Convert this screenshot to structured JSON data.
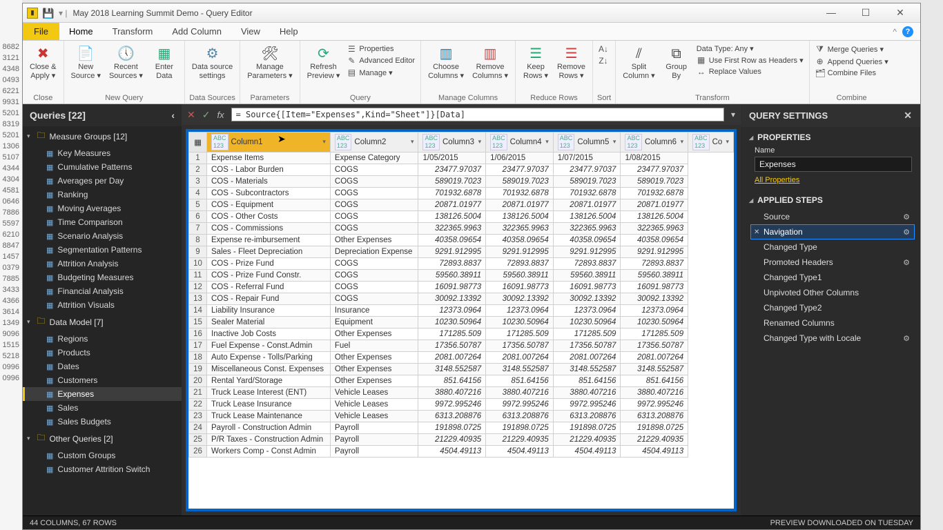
{
  "backdrop_rows": [
    "8682",
    "3121",
    "4348",
    "0493",
    "6221",
    "9931",
    "5201",
    "8319",
    "5201",
    "1306",
    "5107",
    "4344",
    "4304",
    "4581",
    "0646",
    "7886",
    "5597",
    "6210",
    "8847",
    "1457",
    "0379",
    "7885",
    "3433",
    "4366",
    "3614",
    "1349",
    "9096",
    "1515",
    "5218",
    "0996",
    "0996"
  ],
  "window": {
    "title": "May 2018 Learning Summit Demo - Query Editor"
  },
  "menu": {
    "file": "File",
    "tabs": [
      "Home",
      "Transform",
      "Add Column",
      "View",
      "Help"
    ],
    "active": "Home"
  },
  "ribbon": {
    "close": {
      "close": "Close &",
      "apply": "Apply ▾",
      "group": "Close"
    },
    "newquery": {
      "new": "New",
      "source": "Source ▾",
      "recent": "Recent",
      "sources": "Sources ▾",
      "enter": "Enter",
      "data": "Data",
      "group": "New Query"
    },
    "datasources": {
      "ds1": "Data source",
      "ds2": "settings",
      "group": "Data Sources"
    },
    "parameters": {
      "p1": "Manage",
      "p2": "Parameters ▾",
      "group": "Parameters"
    },
    "query": {
      "refresh": "Refresh",
      "preview": "Preview ▾",
      "props": "Properties",
      "adv": "Advanced Editor",
      "manage": "Manage ▾",
      "group": "Query"
    },
    "managecols": {
      "choose1": "Choose",
      "choose2": "Columns ▾",
      "remove1": "Remove",
      "remove2": "Columns ▾",
      "group": "Manage Columns"
    },
    "reducerows": {
      "keep1": "Keep",
      "keep2": "Rows ▾",
      "rm1": "Remove",
      "rm2": "Rows ▾",
      "group": "Reduce Rows"
    },
    "sort": {
      "group": "Sort"
    },
    "split": {
      "s1": "Split",
      "s2": "Column ▾",
      "g1": "Group",
      "g2": "By",
      "group": ""
    },
    "transform": {
      "dt": "Data Type: Any ▾",
      "hdr": "Use First Row as Headers ▾",
      "rep": "Replace Values",
      "group": "Transform"
    },
    "combine": {
      "merge": "Merge Queries ▾",
      "append": "Append Queries ▾",
      "files": "Combine Files",
      "group": "Combine"
    }
  },
  "queries": {
    "header": "Queries [22]",
    "groups": [
      {
        "label": "Measure Groups [12]",
        "items": [
          "Key Measures",
          "Cumulative Patterns",
          "Averages per Day",
          "Ranking",
          "Moving Averages",
          "Time Comparison",
          "Scenario Analysis",
          "Segmentation Patterns",
          "Attrition Analysis",
          "Budgeting Measures",
          "Financial Analysis",
          "Attrition Visuals"
        ]
      },
      {
        "label": "Data Model [7]",
        "items": [
          "Regions",
          "Products",
          "Dates",
          "Customers",
          "Expenses",
          "Sales",
          "Sales Budgets"
        ]
      },
      {
        "label": "Other Queries [2]",
        "items": [
          "Custom Groups",
          "Customer Attrition Switch"
        ]
      }
    ],
    "selected": "Expenses"
  },
  "formula": "= Source{[Item=\"Expenses\",Kind=\"Sheet\"]}[Data]",
  "columns": [
    "Column1",
    "Column2",
    "Column3",
    "Column4",
    "Column5",
    "Column6",
    "Co"
  ],
  "selected_column": 0,
  "header_dates": [
    "Expense Category",
    "1/05/2015",
    "1/06/2015",
    "1/07/2015",
    "1/08/2015"
  ],
  "rows": [
    {
      "n": 1,
      "c1": "Expense Items",
      "c2": "Expense Category",
      "v": [
        "1/05/2015",
        "1/06/2015",
        "1/07/2015",
        "1/08/2015"
      ],
      "txt": true
    },
    {
      "n": 2,
      "c1": "COS - Labor Burden",
      "c2": "COGS",
      "v": [
        "23477.97037",
        "23477.97037",
        "23477.97037",
        "23477.97037"
      ]
    },
    {
      "n": 3,
      "c1": "COS - Materials",
      "c2": "COGS",
      "v": [
        "589019.7023",
        "589019.7023",
        "589019.7023",
        "589019.7023"
      ]
    },
    {
      "n": 4,
      "c1": "COS - Subcontractors",
      "c2": "COGS",
      "v": [
        "701932.6878",
        "701932.6878",
        "701932.6878",
        "701932.6878"
      ]
    },
    {
      "n": 5,
      "c1": "COS - Equipment",
      "c2": "COGS",
      "v": [
        "20871.01977",
        "20871.01977",
        "20871.01977",
        "20871.01977"
      ]
    },
    {
      "n": 6,
      "c1": "COS - Other Costs",
      "c2": "COGS",
      "v": [
        "138126.5004",
        "138126.5004",
        "138126.5004",
        "138126.5004"
      ]
    },
    {
      "n": 7,
      "c1": "COS - Commissions",
      "c2": "COGS",
      "v": [
        "322365.9963",
        "322365.9963",
        "322365.9963",
        "322365.9963"
      ]
    },
    {
      "n": 8,
      "c1": "Expense re-imbursement",
      "c2": "Other Expenses",
      "v": [
        "40358.09654",
        "40358.09654",
        "40358.09654",
        "40358.09654"
      ]
    },
    {
      "n": 9,
      "c1": "Sales - Fleet Depreciation",
      "c2": "Depreciation Expense",
      "v": [
        "9291.912995",
        "9291.912995",
        "9291.912995",
        "9291.912995"
      ]
    },
    {
      "n": 10,
      "c1": "COS - Prize Fund",
      "c2": "COGS",
      "v": [
        "72893.8837",
        "72893.8837",
        "72893.8837",
        "72893.8837"
      ]
    },
    {
      "n": 11,
      "c1": "COS - Prize Fund Constr.",
      "c2": "COGS",
      "v": [
        "59560.38911",
        "59560.38911",
        "59560.38911",
        "59560.38911"
      ]
    },
    {
      "n": 12,
      "c1": "COS - Referral Fund",
      "c2": "COGS",
      "v": [
        "16091.98773",
        "16091.98773",
        "16091.98773",
        "16091.98773"
      ]
    },
    {
      "n": 13,
      "c1": "COS - Repair Fund",
      "c2": "COGS",
      "v": [
        "30092.13392",
        "30092.13392",
        "30092.13392",
        "30092.13392"
      ]
    },
    {
      "n": 14,
      "c1": "Liability Insurance",
      "c2": "Insurance",
      "v": [
        "12373.0964",
        "12373.0964",
        "12373.0964",
        "12373.0964"
      ]
    },
    {
      "n": 15,
      "c1": "Sealer Material",
      "c2": "Equipment",
      "v": [
        "10230.50964",
        "10230.50964",
        "10230.50964",
        "10230.50964"
      ]
    },
    {
      "n": 16,
      "c1": "Inactive Job Costs",
      "c2": "Other Expenses",
      "v": [
        "171285.509",
        "171285.509",
        "171285.509",
        "171285.509"
      ]
    },
    {
      "n": 17,
      "c1": "Fuel Expense - Const.Admin",
      "c2": "Fuel",
      "v": [
        "17356.50787",
        "17356.50787",
        "17356.50787",
        "17356.50787"
      ]
    },
    {
      "n": 18,
      "c1": "Auto Expense - Tolls/Parking",
      "c2": "Other Expenses",
      "v": [
        "2081.007264",
        "2081.007264",
        "2081.007264",
        "2081.007264"
      ]
    },
    {
      "n": 19,
      "c1": "Miscellaneous Const. Expenses",
      "c2": "Other Expenses",
      "v": [
        "3148.552587",
        "3148.552587",
        "3148.552587",
        "3148.552587"
      ]
    },
    {
      "n": 20,
      "c1": "Rental Yard/Storage",
      "c2": "Other Expenses",
      "v": [
        "851.64156",
        "851.64156",
        "851.64156",
        "851.64156"
      ]
    },
    {
      "n": 21,
      "c1": "Truck Lease Interest (ENT)",
      "c2": "Vehicle Leases",
      "v": [
        "3880.407216",
        "3880.407216",
        "3880.407216",
        "3880.407216"
      ]
    },
    {
      "n": 22,
      "c1": "Truck Lease Insurance",
      "c2": "Vehicle Leases",
      "v": [
        "9972.995246",
        "9972.995246",
        "9972.995246",
        "9972.995246"
      ]
    },
    {
      "n": 23,
      "c1": "Truck Lease Maintenance",
      "c2": "Vehicle Leases",
      "v": [
        "6313.208876",
        "6313.208876",
        "6313.208876",
        "6313.208876"
      ]
    },
    {
      "n": 24,
      "c1": "Payroll - Construction Admin",
      "c2": "Payroll",
      "v": [
        "191898.0725",
        "191898.0725",
        "191898.0725",
        "191898.0725"
      ]
    },
    {
      "n": 25,
      "c1": "P/R Taxes - Construction Admin",
      "c2": "Payroll",
      "v": [
        "21229.40935",
        "21229.40935",
        "21229.40935",
        "21229.40935"
      ]
    },
    {
      "n": 26,
      "c1": "Workers Comp - Const Admin",
      "c2": "Payroll",
      "v": [
        "4504.49113",
        "4504.49113",
        "4504.49113",
        "4504.49113"
      ]
    }
  ],
  "settings": {
    "header": "QUERY SETTINGS",
    "properties": "PROPERTIES",
    "name_label": "Name",
    "name_value": "Expenses",
    "all_props": "All Properties",
    "applied": "APPLIED STEPS",
    "steps": [
      {
        "label": "Source",
        "gear": true
      },
      {
        "label": "Navigation",
        "gear": true,
        "selected": true,
        "x": true
      },
      {
        "label": "Changed Type"
      },
      {
        "label": "Promoted Headers",
        "gear": true
      },
      {
        "label": "Changed Type1"
      },
      {
        "label": "Unpivoted Other Columns"
      },
      {
        "label": "Changed Type2"
      },
      {
        "label": "Renamed Columns"
      },
      {
        "label": "Changed Type with Locale",
        "gear": true
      }
    ]
  },
  "status": {
    "left": "44 COLUMNS, 67 ROWS",
    "right": "PREVIEW DOWNLOADED ON TUESDAY"
  }
}
